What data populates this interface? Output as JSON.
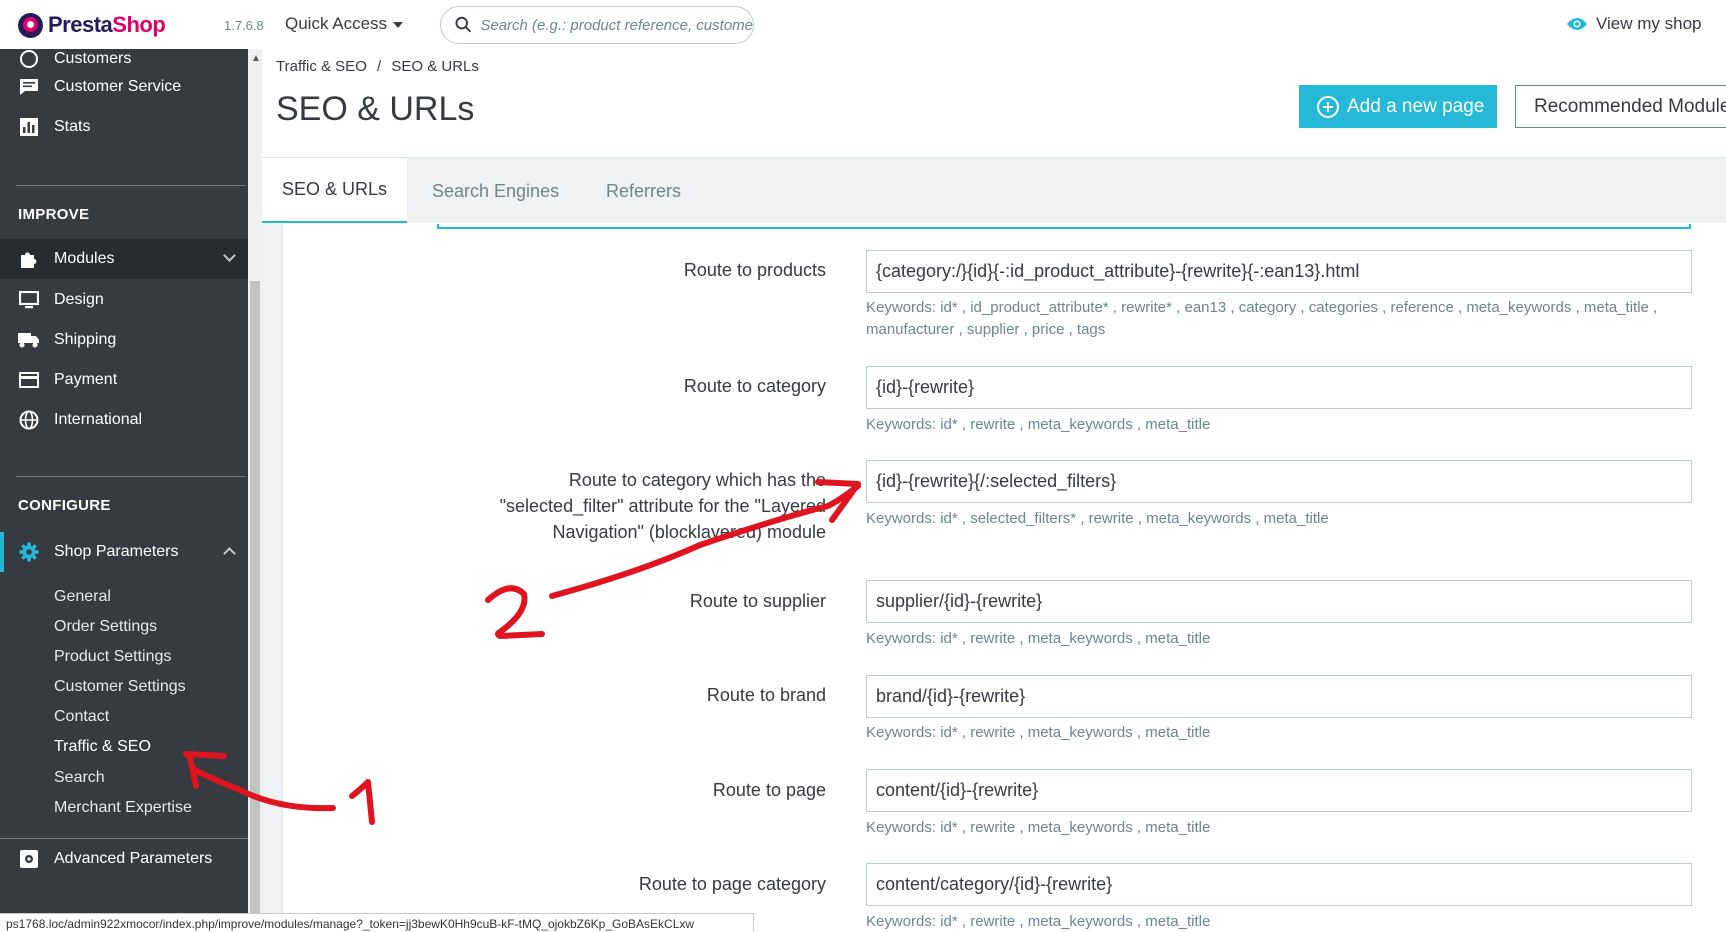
{
  "header": {
    "logo_prefix": "Presta",
    "logo_suffix": "Shop",
    "version": "1.7.6.8",
    "quick_access": "Quick Access",
    "search_placeholder": "Search (e.g.: product reference, custome",
    "view_shop": "View my shop"
  },
  "sidebar": {
    "partial_item": "Customers",
    "items_top": [
      {
        "label": "Customer Service",
        "icon": "chat-icon"
      },
      {
        "label": "Stats",
        "icon": "bar-chart-icon"
      }
    ],
    "improve_title": "IMPROVE",
    "improve_items": [
      {
        "label": "Modules",
        "icon": "puzzle-icon"
      },
      {
        "label": "Design",
        "icon": "monitor-icon"
      },
      {
        "label": "Shipping",
        "icon": "truck-icon"
      },
      {
        "label": "Payment",
        "icon": "credit-card-icon"
      },
      {
        "label": "International",
        "icon": "globe-icon"
      }
    ],
    "configure_title": "CONFIGURE",
    "shop_parameters": "Shop Parameters",
    "sub_items": [
      "General",
      "Order Settings",
      "Product Settings",
      "Customer Settings",
      "Contact",
      "Traffic & SEO",
      "Search",
      "Merchant Expertise"
    ],
    "active_sub": "Traffic & SEO",
    "advanced": "Advanced Parameters"
  },
  "status_url": "ps1768.loc/admin922xmocor/index.php/improve/modules/manage?_token=jj3bewK0Hh9cuB-kF-tMQ_ojokbZ6Kp_GoBAsEkCLxw",
  "breadcrumb": {
    "parent": "Traffic & SEO",
    "sep": "/",
    "current": "SEO & URLs"
  },
  "page_title": "SEO & URLs",
  "buttons": {
    "add_page": "Add a new page",
    "recommended": "Recommended Modules"
  },
  "tabs": [
    "SEO & URLs",
    "Search Engines",
    "Referrers"
  ],
  "routes": [
    {
      "label": "Route to products",
      "value": "{category:/}{id}{-:id_product_attribute}-{rewrite}{-:ean13}.html",
      "keywords": "Keywords: id* , id_product_attribute* , rewrite* , ean13 , category , categories , reference , meta_keywords , meta_title , manufacturer , supplier , price , tags"
    },
    {
      "label": "Route to category",
      "value": "{id}-{rewrite}",
      "keywords": "Keywords: id* , rewrite , meta_keywords , meta_title"
    },
    {
      "label": "Route to category which has the \"selected_filter\" attribute for the \"Layered Navigation\" (blocklayered) module",
      "value": "{id}-{rewrite}{/:selected_filters}",
      "keywords": "Keywords: id* , selected_filters* , rewrite , meta_keywords , meta_title"
    },
    {
      "label": "Route to supplier",
      "value": "supplier/{id}-{rewrite}",
      "keywords": "Keywords: id* , rewrite , meta_keywords , meta_title"
    },
    {
      "label": "Route to brand",
      "value": "brand/{id}-{rewrite}",
      "keywords": "Keywords: id* , rewrite , meta_keywords , meta_title"
    },
    {
      "label": "Route to page",
      "value": "content/{id}-{rewrite}",
      "keywords": "Keywords: id* , rewrite , meta_keywords , meta_title"
    },
    {
      "label": "Route to page category",
      "value": "content/category/{id}-{rewrite}",
      "keywords": "Keywords: id* , rewrite , meta_keywords , meta_title"
    }
  ],
  "colors": {
    "accent": "#25b9d7",
    "sidebar": "#363a41",
    "annotation": "#e0141e"
  }
}
